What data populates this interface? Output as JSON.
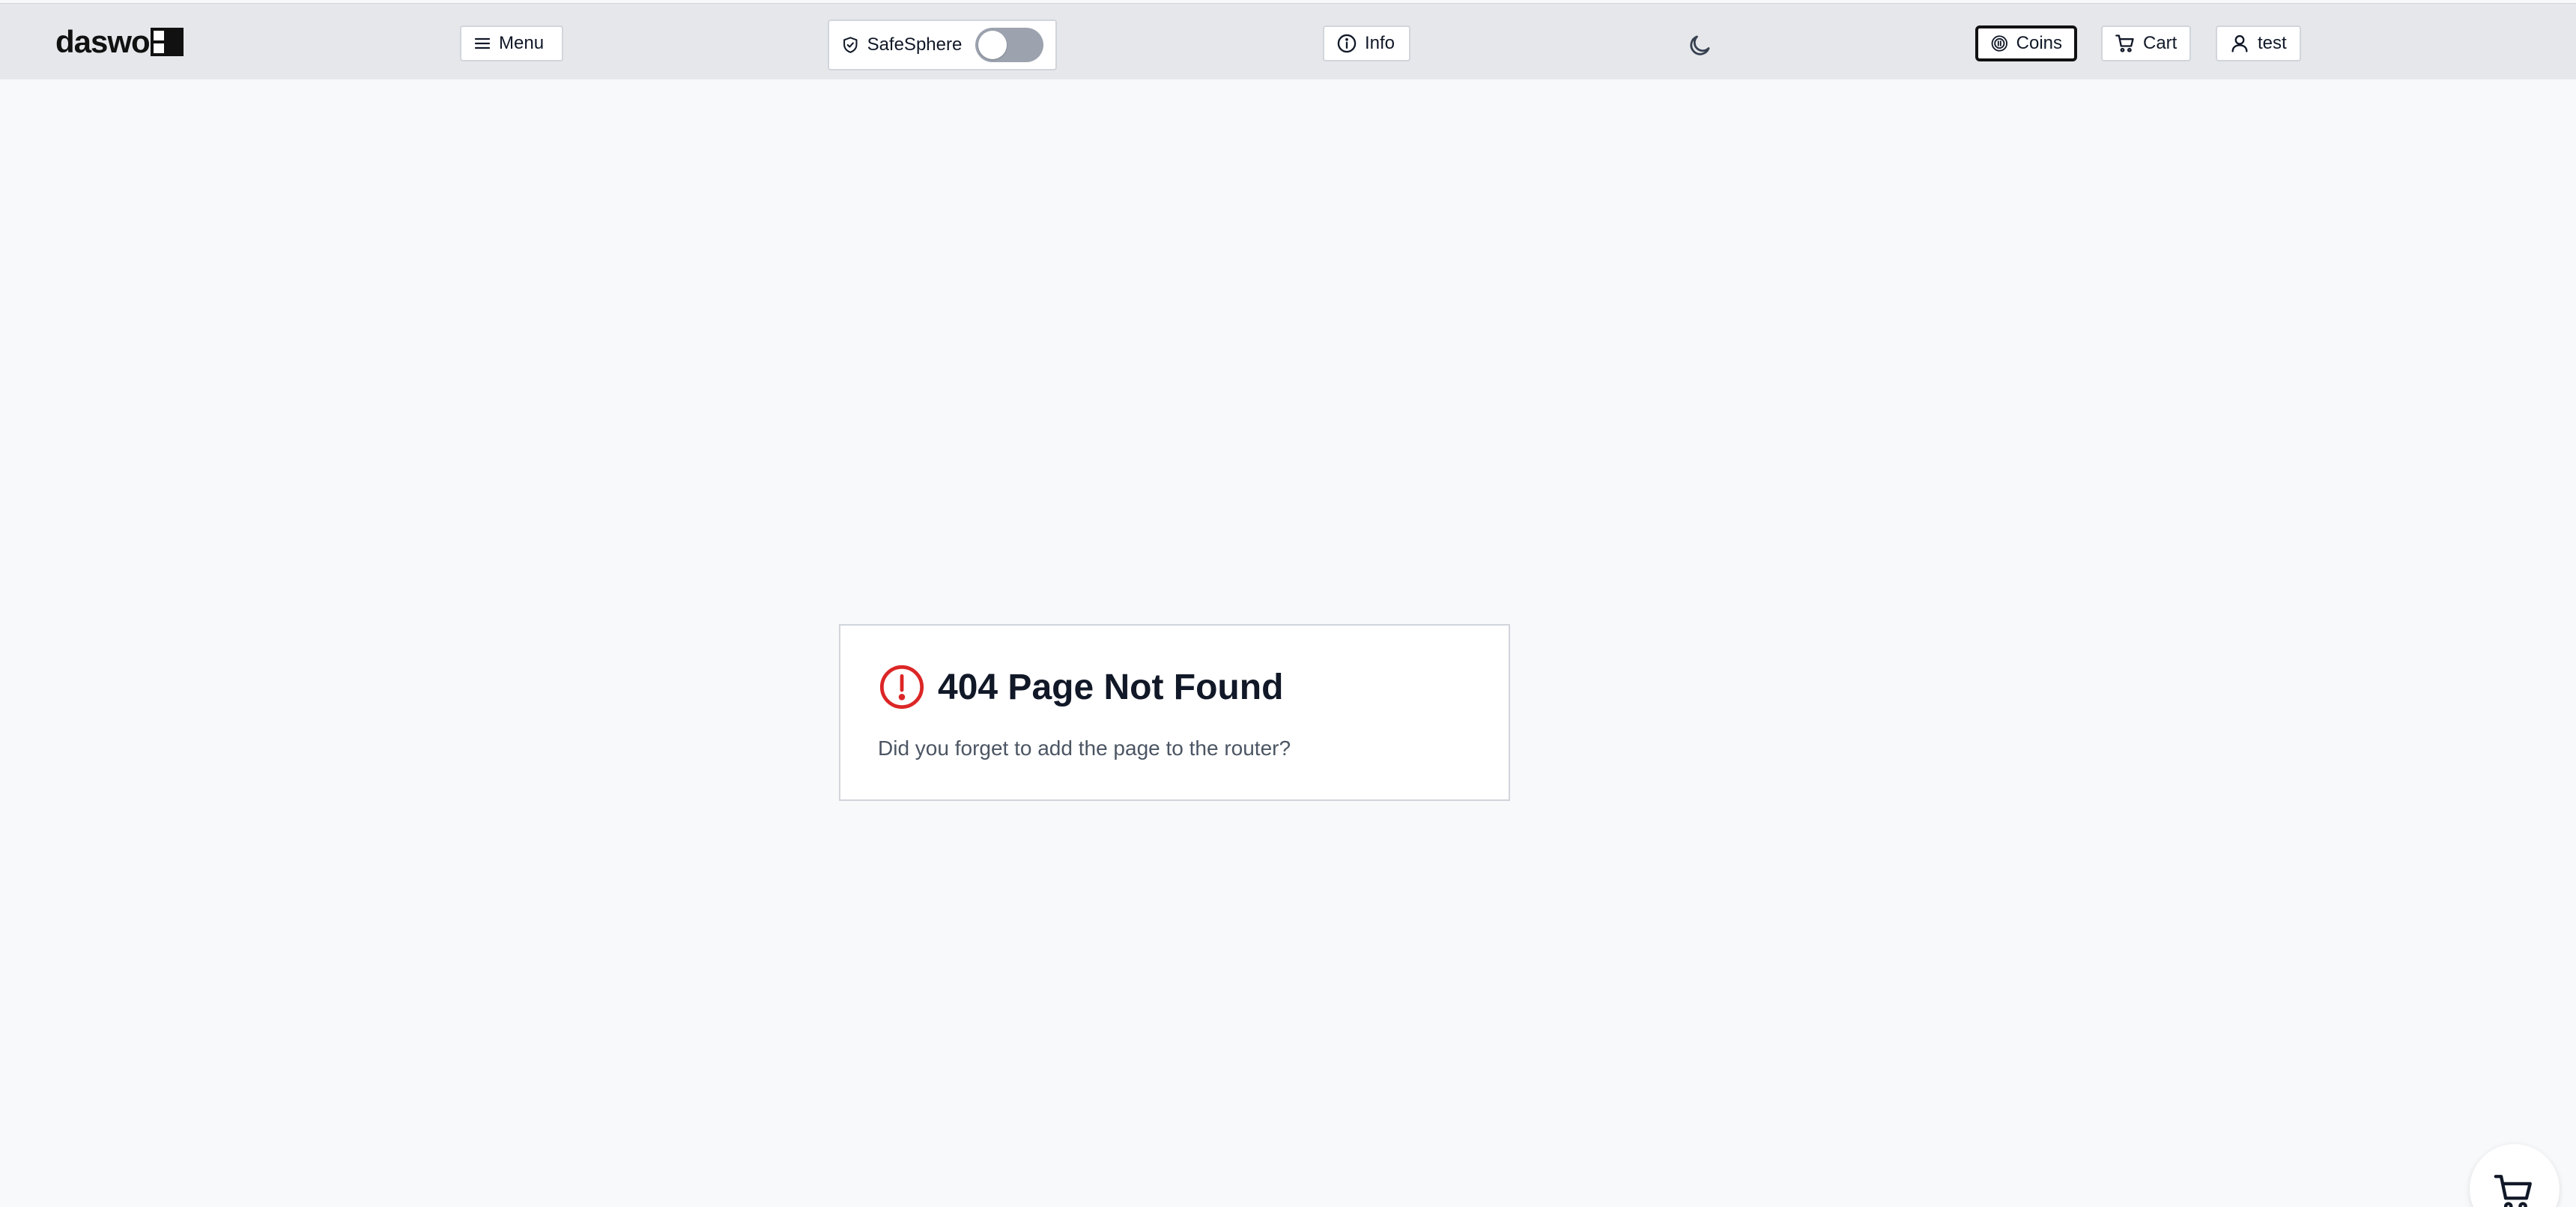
{
  "header": {
    "logo_text": "daswo",
    "menu_label": "Menu",
    "safesphere_label": "SafeSphere",
    "safesphere_enabled": false,
    "info_label": "Info",
    "coins_label": "Coins",
    "cart_label": "Cart",
    "user_label": "test"
  },
  "icons": {
    "menu": "hamburger-icon",
    "safesphere": "shield-check-icon",
    "info": "info-circle-icon",
    "theme": "moon-icon",
    "coins": "coin-icon",
    "cart": "shopping-cart-icon",
    "user": "user-icon",
    "error": "exclamation-circle-icon"
  },
  "error_card": {
    "title": "404 Page Not Found",
    "message": "Did you forget to add the page to the router?"
  },
  "colors": {
    "error_accent": "#dc2626",
    "topbar_bg": "#e5e7eb",
    "page_bg": "#f8f9fb"
  }
}
